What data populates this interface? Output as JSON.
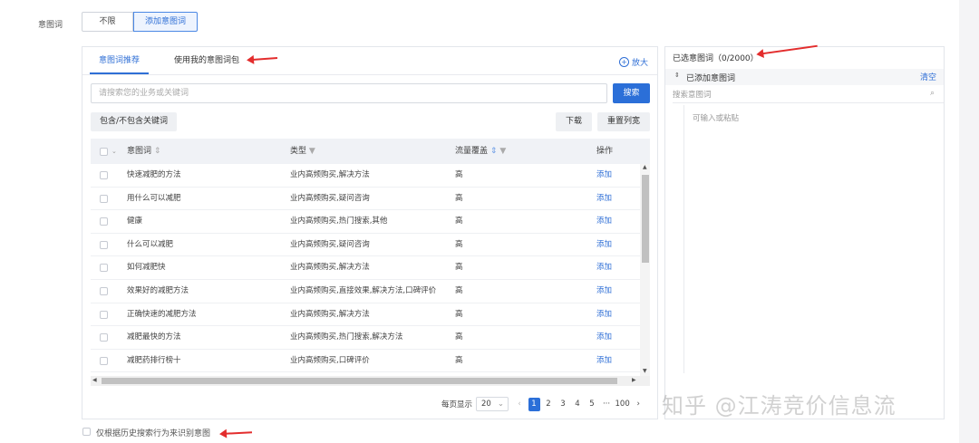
{
  "intent_row": {
    "label": "意图词",
    "options": [
      "不限",
      "添加意图词"
    ]
  },
  "left_panel": {
    "tabs": [
      "意图词推荐",
      "使用我的意图词包"
    ],
    "zoom_label": "放大",
    "search_placeholder": "请搜索您的业务或关键词",
    "search_button": "搜索",
    "include_button": "包含/不包含关键词",
    "download_button": "下载",
    "reset_columns_button": "重置列宽",
    "columns": [
      "意图词",
      "类型",
      "流量覆盖",
      "操作"
    ],
    "rows": [
      {
        "word": "快速减肥的方法",
        "type": "业内高频购买,解决方法",
        "traffic": "高",
        "action": "添加"
      },
      {
        "word": "用什么可以减肥",
        "type": "业内高频购买,疑问咨询",
        "traffic": "高",
        "action": "添加"
      },
      {
        "word": "健康",
        "type": "业内高频购买,热门搜索,其他",
        "traffic": "高",
        "action": "添加"
      },
      {
        "word": "什么可以减肥",
        "type": "业内高频购买,疑问咨询",
        "traffic": "高",
        "action": "添加"
      },
      {
        "word": "如何减肥快",
        "type": "业内高频购买,解决方法",
        "traffic": "高",
        "action": "添加"
      },
      {
        "word": "效果好的减肥方法",
        "type": "业内高频购买,直接效果,解决方法,口碑评价",
        "traffic": "高",
        "action": "添加"
      },
      {
        "word": "正确快速的减肥方法",
        "type": "业内高频购买,解决方法",
        "traffic": "高",
        "action": "添加"
      },
      {
        "word": "减肥最快的方法",
        "type": "业内高频购买,热门搜索,解决方法",
        "traffic": "高",
        "action": "添加"
      },
      {
        "word": "减肥药排行榜十",
        "type": "业内高频购买,口碑评价",
        "traffic": "高",
        "action": "添加"
      }
    ],
    "pager": {
      "per_page_label": "每页显示",
      "per_page": "20",
      "pages": [
        "1",
        "2",
        "3",
        "4",
        "5",
        "···",
        "100"
      ],
      "current": "1"
    }
  },
  "right_panel": {
    "title": "已选意图词（0/2000）",
    "added_label": "已添加意图词",
    "clear_label": "清空",
    "search_placeholder": "搜索意图词",
    "input_placeholder": "可输入或粘贴"
  },
  "footer": {
    "checkbox_label": "仅根据历史搜索行为来识别意图"
  },
  "watermark": "知乎 @江涛竞价信息流",
  "colors": {
    "accent": "#2b6fd8",
    "arrow": "#e32d2d"
  }
}
